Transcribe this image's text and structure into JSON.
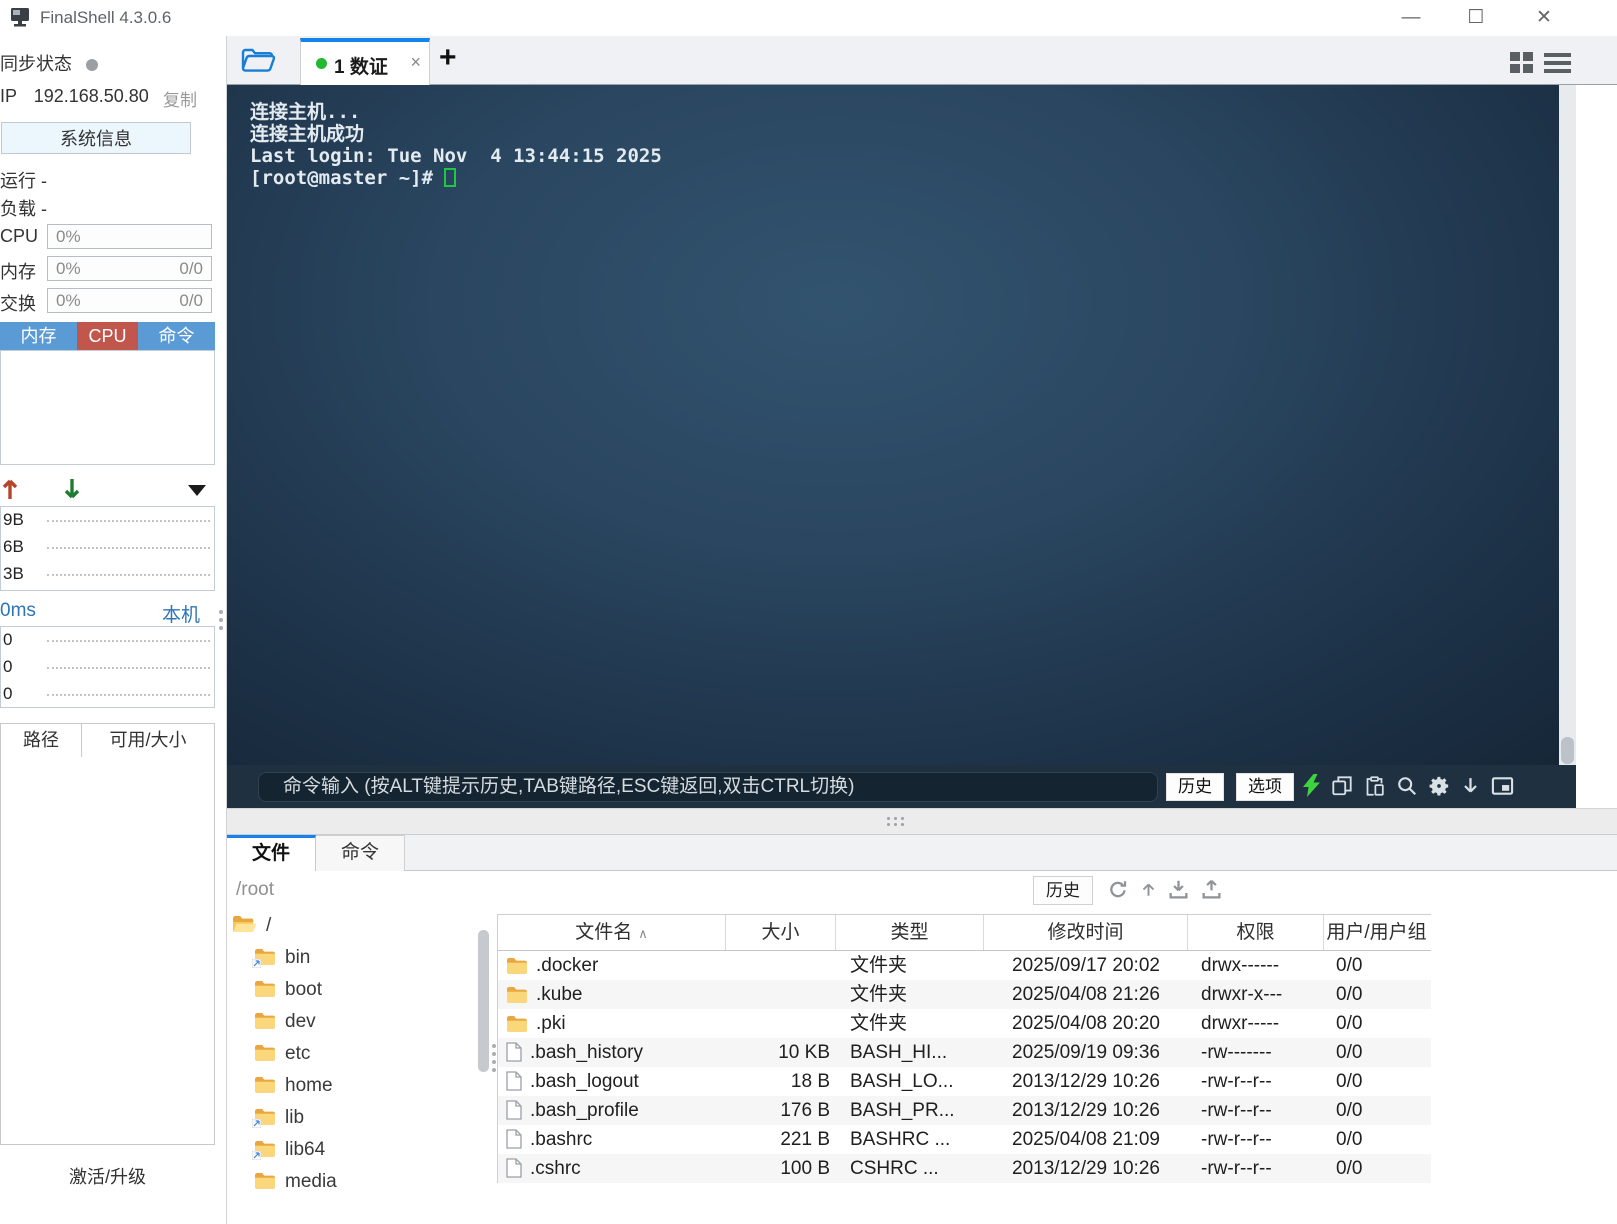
{
  "titlebar": {
    "title": "FinalShell 4.3.0.6"
  },
  "window_controls": {
    "minimize": "—",
    "maximize": "☐",
    "close": "✕"
  },
  "sidebar": {
    "sync_label": "同步状态",
    "ip_label": "IP",
    "ip_value": "192.168.50.80",
    "copy_label": "复制",
    "sysinfo_button": "系统信息",
    "run_label": "运行 -",
    "load_label": "负载 -",
    "stats": [
      {
        "label": "CPU",
        "value": "0%",
        "extra": ""
      },
      {
        "label": "内存",
        "value": "0%",
        "extra": "0/0"
      },
      {
        "label": "交换",
        "value": "0%",
        "extra": "0/0"
      }
    ],
    "chart_tabs": [
      {
        "label": "内存",
        "color": "#5b9bd5",
        "active": false
      },
      {
        "label": "CPU",
        "color": "#c0564c",
        "active": true
      },
      {
        "label": "命令",
        "color": "#5b9bd5",
        "active": false
      }
    ],
    "net_ticks": [
      "9B",
      "6B",
      "3B"
    ],
    "ping_value": "0ms",
    "local_label": "本机",
    "ping_ticks": [
      "0",
      "0",
      "0"
    ],
    "path_header": [
      "路径",
      "可用/大小"
    ],
    "activate_label": "激活/升级"
  },
  "tabbar": {
    "tab_label": "1 数证",
    "close": "×",
    "new_tab": "+"
  },
  "terminal": {
    "lines": [
      "连接主机...",
      "连接主机成功",
      "Last login: Tue Nov  4 13:44:15 2025"
    ],
    "prompt": "[root@master ~]# "
  },
  "command_bar": {
    "placeholder": "命令输入 (按ALT键提示历史,TAB键路径,ESC键返回,双击CTRL切换)",
    "history_button": "历史",
    "options_button": "选项",
    "icons": [
      "lightning",
      "copy",
      "paste",
      "search",
      "settings",
      "download",
      "window"
    ]
  },
  "bottom_panel": {
    "files_tab": "文件",
    "commands_tab": "命令",
    "path": "/root",
    "history_button": "历史",
    "icons": [
      "refresh",
      "up",
      "download-tray",
      "upload-tray"
    ],
    "tree": [
      {
        "label": "/",
        "root": true,
        "link": false
      },
      {
        "label": "bin",
        "root": false,
        "link": true
      },
      {
        "label": "boot",
        "root": false,
        "link": false
      },
      {
        "label": "dev",
        "root": false,
        "link": false
      },
      {
        "label": "etc",
        "root": false,
        "link": false
      },
      {
        "label": "home",
        "root": false,
        "link": false
      },
      {
        "label": "lib",
        "root": false,
        "link": true
      },
      {
        "label": "lib64",
        "root": false,
        "link": true
      },
      {
        "label": "media",
        "root": false,
        "link": false
      }
    ],
    "table": {
      "headers": [
        "文件名",
        "大小",
        "类型",
        "修改时间",
        "权限",
        "用户/用户组"
      ],
      "sort_indicator": "∧",
      "rows": [
        {
          "name": ".docker",
          "size": "",
          "type": "文件夹",
          "mtime": "2025/09/17 20:02",
          "perm": "drwx------",
          "owner": "0/0",
          "kind": "folder"
        },
        {
          "name": ".kube",
          "size": "",
          "type": "文件夹",
          "mtime": "2025/04/08 21:26",
          "perm": "drwxr-x---",
          "owner": "0/0",
          "kind": "folder"
        },
        {
          "name": ".pki",
          "size": "",
          "type": "文件夹",
          "mtime": "2025/04/08 20:20",
          "perm": "drwxr-----",
          "owner": "0/0",
          "kind": "folder"
        },
        {
          "name": ".bash_history",
          "size": "10 KB",
          "type": "BASH_HI...",
          "mtime": "2025/09/19 09:36",
          "perm": "-rw-------",
          "owner": "0/0",
          "kind": "file"
        },
        {
          "name": ".bash_logout",
          "size": "18 B",
          "type": "BASH_LO...",
          "mtime": "2013/12/29 10:26",
          "perm": "-rw-r--r--",
          "owner": "0/0",
          "kind": "file"
        },
        {
          "name": ".bash_profile",
          "size": "176 B",
          "type": "BASH_PR...",
          "mtime": "2013/12/29 10:26",
          "perm": "-rw-r--r--",
          "owner": "0/0",
          "kind": "file"
        },
        {
          "name": ".bashrc",
          "size": "221 B",
          "type": "BASHRC ...",
          "mtime": "2025/04/08 21:09",
          "perm": "-rw-r--r--",
          "owner": "0/0",
          "kind": "file"
        },
        {
          "name": ".cshrc",
          "size": "100 B",
          "type": "CSHRC ...",
          "mtime": "2013/12/29 10:26",
          "perm": "-rw-r--r--",
          "owner": "0/0",
          "kind": "file"
        }
      ]
    }
  },
  "colors": {
    "accent_blue": "#1483eb",
    "sidebar_tab_blue": "#5b9bd5",
    "sidebar_tab_red": "#c0564c",
    "link_blue": "#2e75b6",
    "cursor_green": "#1fc742",
    "folder_yellow": "#fbd77c"
  }
}
